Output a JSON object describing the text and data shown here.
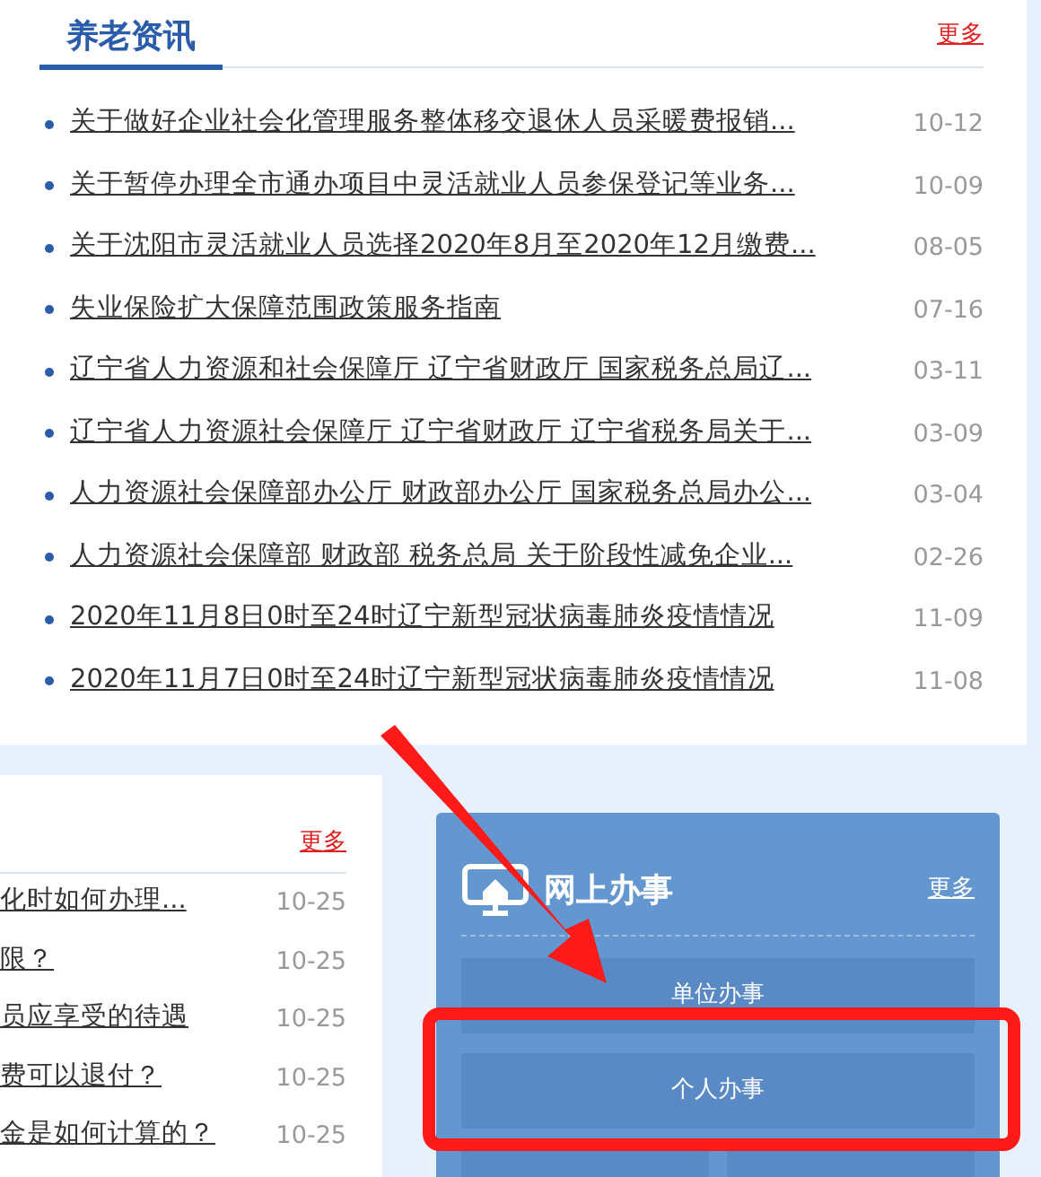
{
  "news_panel": {
    "title": "养老资讯",
    "more": "更多",
    "items": [
      {
        "title": "关于做好企业社会化管理服务整体移交退休人员采暖费报销...",
        "date": "10-12"
      },
      {
        "title": "关于暂停办理全市通办项目中灵活就业人员参保登记等业务...",
        "date": "10-09"
      },
      {
        "title": "关于沈阳市灵活就业人员选择2020年8月至2020年12月缴费...",
        "date": "08-05"
      },
      {
        "title": "失业保险扩大保障范围政策服务指南",
        "date": "07-16"
      },
      {
        "title": "辽宁省人力资源和社会保障厅 辽宁省财政厅 国家税务总局辽...",
        "date": "03-11"
      },
      {
        "title": "辽宁省人力资源社会保障厅 辽宁省财政厅 辽宁省税务局关于...",
        "date": "03-09"
      },
      {
        "title": "人力资源社会保障部办公厅 财政部办公厅 国家税务总局办公...",
        "date": "03-04"
      },
      {
        "title": "人力资源社会保障部 财政部 税务总局 关于阶段性减免企业...",
        "date": "02-26"
      },
      {
        "title": "2020年11月8日0时至24时辽宁新型冠状病毒肺炎疫情情况",
        "date": "11-09"
      },
      {
        "title": "2020年11月7日0时至24时辽宁新型冠状病毒肺炎疫情情况",
        "date": "11-08"
      }
    ]
  },
  "faq_panel": {
    "more": "更多",
    "items": [
      {
        "title": "化时如何办理...",
        "date": "10-25"
      },
      {
        "title": "限？",
        "date": "10-25"
      },
      {
        "title": "员应享受的待遇",
        "date": "10-25"
      },
      {
        "title": "费可以退付？",
        "date": "10-25"
      },
      {
        "title": "金是如何计算的？",
        "date": "10-25"
      }
    ]
  },
  "online_services": {
    "title": "网上办事",
    "more": "更多",
    "buttons": [
      {
        "kind": "full",
        "label": "单位办事"
      },
      {
        "kind": "full",
        "label": "个人办事"
      },
      {
        "kind": "half"
      },
      {
        "kind": "half"
      }
    ]
  }
}
